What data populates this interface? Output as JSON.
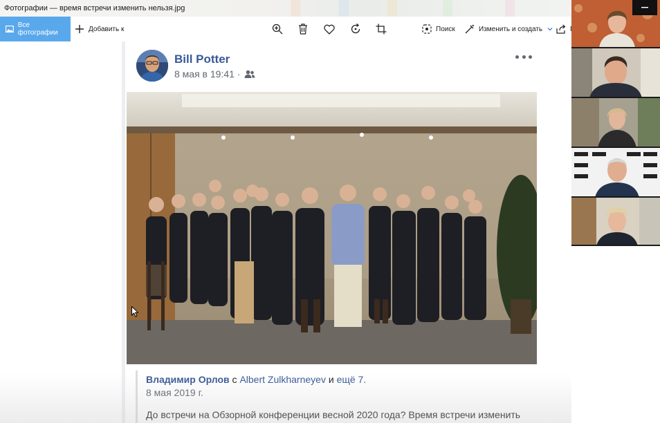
{
  "window": {
    "title": "Фотографии — время встречи изменить нельзя.jpg"
  },
  "toolbar": {
    "all_photos_label": "Все фотографии",
    "add_label": "Добавить к",
    "search_label": "Поиск",
    "edit_create_label": "Изменить и создать",
    "share_label": "П",
    "icons": [
      "zoom-in-icon",
      "delete-icon",
      "heart-icon",
      "rotate-icon",
      "crop-icon"
    ],
    "accent_color": "#5aa8ec"
  },
  "post": {
    "author": "Bill Potter",
    "meta": "8 мая в 19:41 ·",
    "audience_icon": "friends-icon",
    "shared": {
      "author": "Владимир Орлов",
      "with": "с",
      "tagged": "Albert Zulkharneyev",
      "and": "и",
      "others": "ещё 7.",
      "date": "8 мая 2019 г.",
      "text": "До встречи на Обзорной конференции весной 2020 года? Время встречи изменить"
    },
    "link_color": "#385898"
  },
  "participants": {
    "count": 5
  }
}
